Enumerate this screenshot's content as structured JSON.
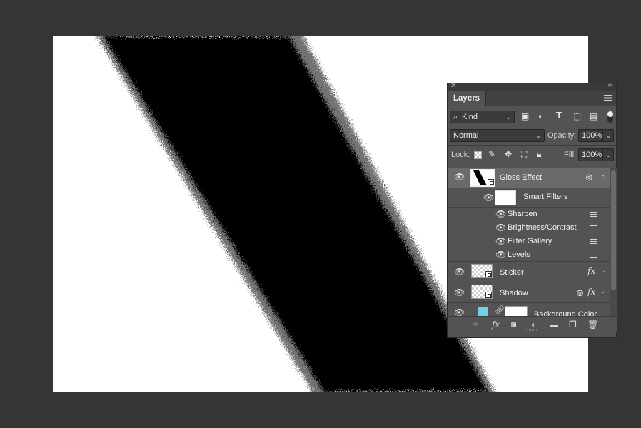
{
  "panel": {
    "tab_label": "Layers",
    "close_glyph": "✕",
    "collapse_glyph": "‹‹",
    "filter": {
      "value": "Kind"
    },
    "blend_mode": {
      "value": "Normal"
    },
    "opacity": {
      "label": "Opacity:",
      "value": "100%"
    },
    "lock": {
      "label": "Lock:"
    },
    "fill": {
      "label": "Fill:",
      "value": "100%"
    }
  },
  "layers": {
    "gloss": {
      "name": "Gloss Effect"
    },
    "smart_filters": {
      "name": "Smart Filters"
    },
    "filters": [
      {
        "name": "Sharpen"
      },
      {
        "name": "Brightness/Contrast"
      },
      {
        "name": "Filter Gallery"
      },
      {
        "name": "Levels"
      }
    ],
    "sticker": {
      "name": "Sticker"
    },
    "shadow": {
      "name": "Shadow"
    },
    "background": {
      "name": "Background Color",
      "swatch_color": "#6fd0e6"
    }
  },
  "colors": {
    "workspace": "#353535",
    "panel": "#535353",
    "selected_row": "#6a6a6a"
  }
}
